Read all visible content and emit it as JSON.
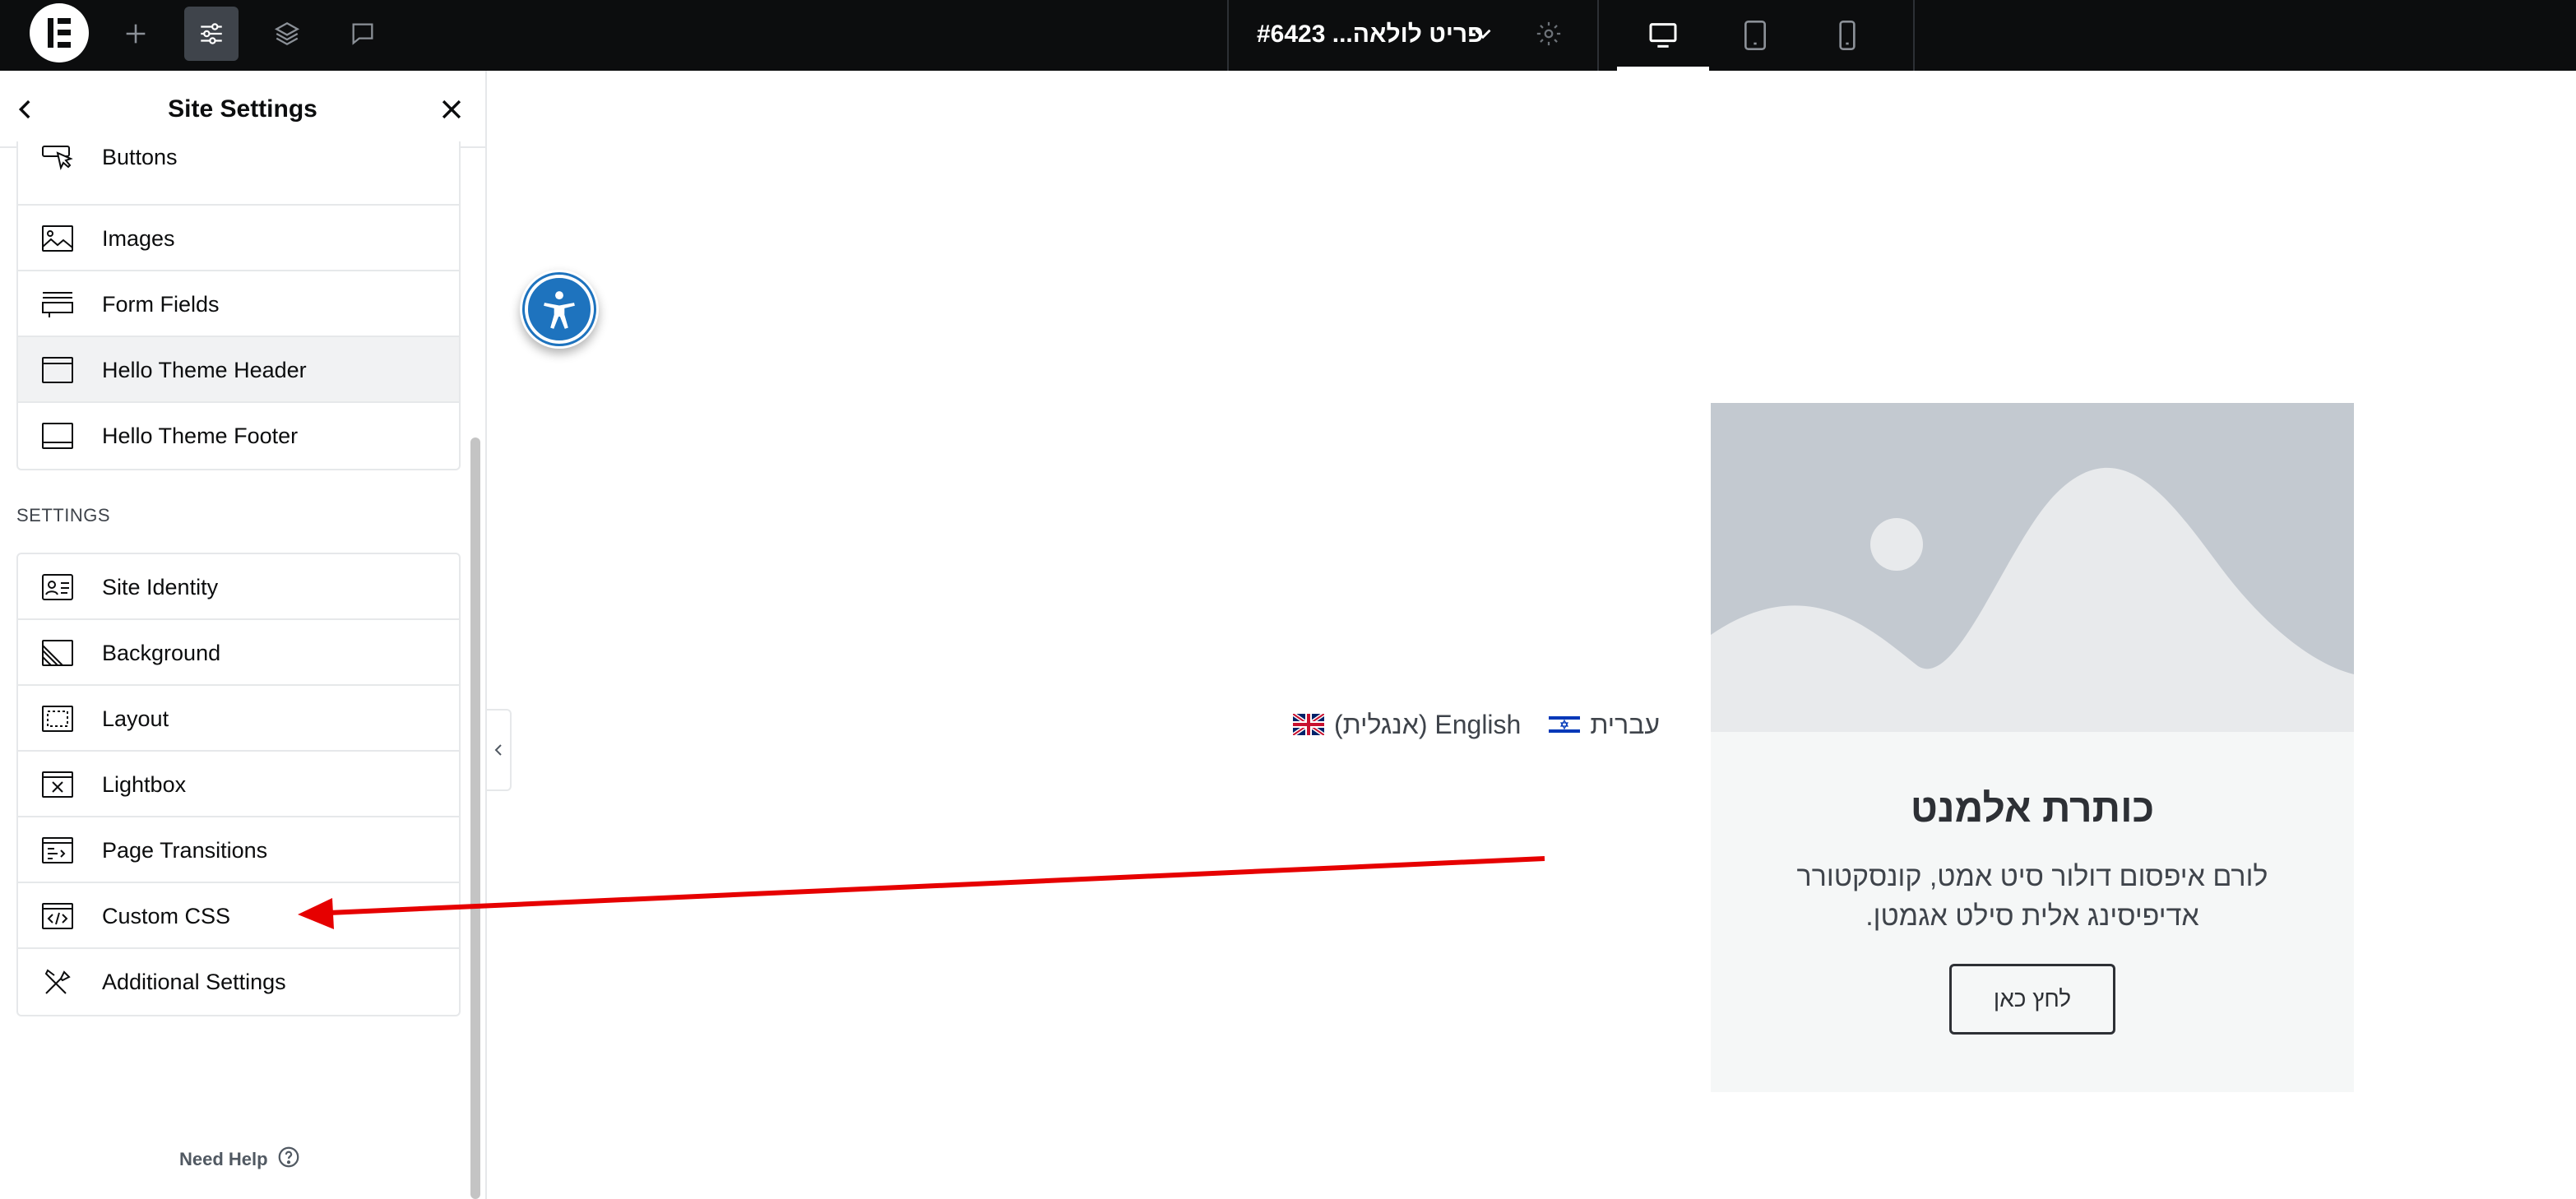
{
  "topbar": {
    "document_title": "#6423 ...פריט לולאה",
    "icons": [
      "elementor-logo",
      "add-icon",
      "site-settings-icon",
      "layers-icon",
      "comments-icon",
      "chevron-down-icon",
      "gear-icon",
      "desktop-icon",
      "tablet-icon",
      "mobile-icon"
    ]
  },
  "sidebar": {
    "title": "Site Settings",
    "design_items": [
      {
        "label": "Buttons",
        "icon": "pointer-click-icon"
      },
      {
        "label": "Images",
        "icon": "image-icon"
      },
      {
        "label": "Form Fields",
        "icon": "form-fields-icon"
      },
      {
        "label": "Hello Theme Header",
        "icon": "header-icon"
      },
      {
        "label": "Hello Theme Footer",
        "icon": "footer-icon"
      }
    ],
    "settings_label": "SETTINGS",
    "settings_items": [
      {
        "label": "Site Identity",
        "icon": "site-identity-icon"
      },
      {
        "label": "Background",
        "icon": "background-icon"
      },
      {
        "label": "Layout",
        "icon": "layout-icon"
      },
      {
        "label": "Lightbox",
        "icon": "lightbox-icon"
      },
      {
        "label": "Page Transitions",
        "icon": "page-transitions-icon"
      },
      {
        "label": "Custom CSS",
        "icon": "custom-css-icon"
      },
      {
        "label": "Additional Settings",
        "icon": "tools-icon"
      }
    ],
    "need_help": "Need Help"
  },
  "canvas": {
    "languages": [
      {
        "label": "English (אנגלית)",
        "flag": "uk-flag"
      },
      {
        "label": "עברית",
        "flag": "israel-flag"
      }
    ],
    "card": {
      "title": "כותרת אלמנט",
      "text": "לורם איפסום דולור סיט אמט, קונסקטורר אדיפיסינג אלית סילט אגמטן.",
      "button": "לחץ כאן"
    }
  },
  "colors": {
    "topbar_bg": "#0c0d0e",
    "accessibility_blue": "#1e73be",
    "annotation_arrow": "#e60000",
    "placeholder_gray": "#c3c9d0"
  }
}
